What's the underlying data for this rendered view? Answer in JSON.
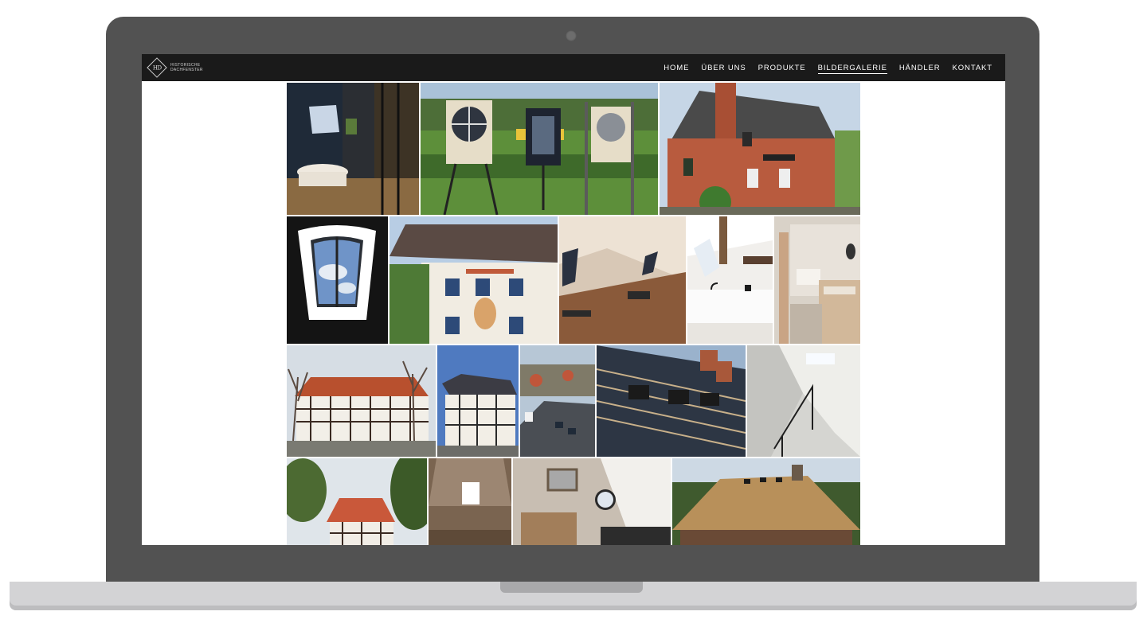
{
  "brand": {
    "logo_monogram": "HD",
    "logo_line1": "HISTORISCHE",
    "logo_line2": "DACHFENSTER"
  },
  "nav": {
    "items": [
      {
        "label": "HOME",
        "active": false
      },
      {
        "label": "ÜBER UNS",
        "active": false
      },
      {
        "label": "PRODUKTE",
        "active": false
      },
      {
        "label": "BILDERGALERIE",
        "active": true
      },
      {
        "label": "HÄNDLER",
        "active": false
      },
      {
        "label": "KONTAKT",
        "active": false
      }
    ]
  },
  "gallery": {
    "photos": [
      {
        "subject": "dark-bathroom-skylight"
      },
      {
        "subject": "window-display-garden"
      },
      {
        "subject": "brick-house-exterior"
      },
      {
        "subject": "arched-skylight-closeup"
      },
      {
        "subject": "painted-facade-house"
      },
      {
        "subject": "attic-room-skylights"
      },
      {
        "subject": "white-bathroom-sink"
      },
      {
        "subject": "white-attic-bedroom"
      },
      {
        "subject": "half-timbered-manor"
      },
      {
        "subject": "half-timbered-corner-house"
      },
      {
        "subject": "slate-roof-village"
      },
      {
        "subject": "roof-installation-skylights"
      },
      {
        "subject": "white-stairwell-skylight"
      },
      {
        "subject": "timber-house-trees"
      },
      {
        "subject": "attic-small-window"
      },
      {
        "subject": "round-window-bathroom"
      },
      {
        "subject": "thatched-roof-house"
      }
    ]
  },
  "colors": {
    "nav_bg": "#1a1a1a",
    "laptop_body": "#525252",
    "laptop_base": "#d3d3d5"
  }
}
